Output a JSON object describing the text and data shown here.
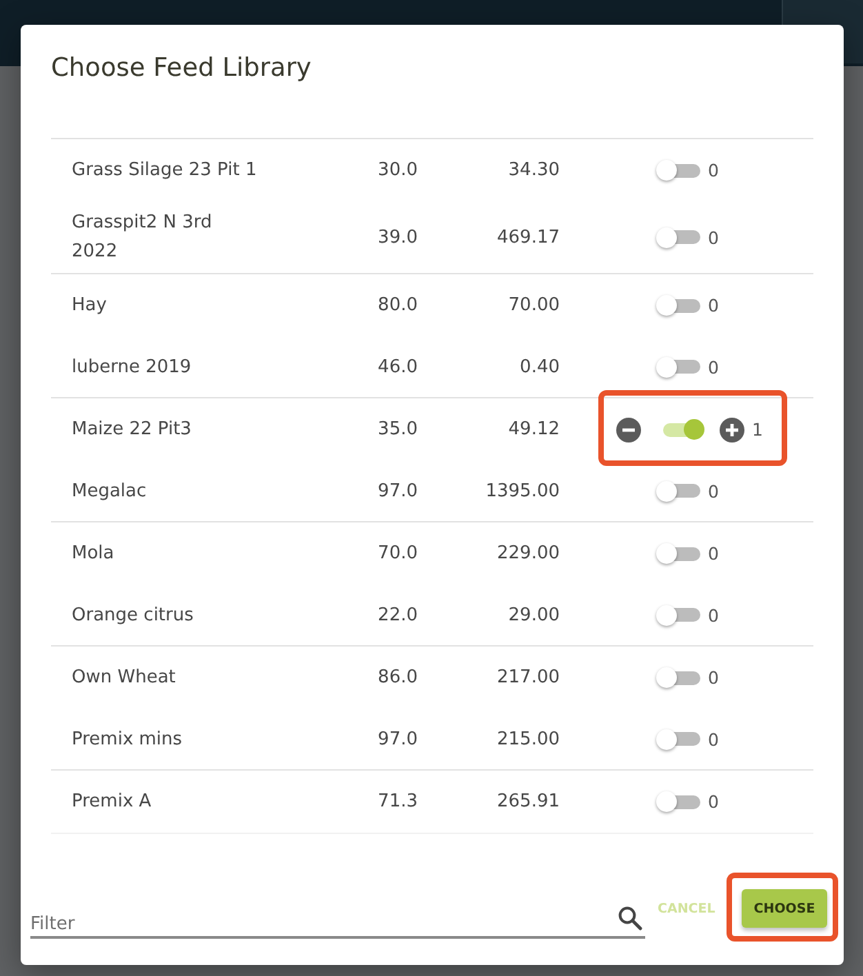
{
  "dialog": {
    "title": "Choose Feed Library"
  },
  "rows": [
    {
      "name": "Grass Silage 23 Pit 1",
      "column_2": "30.0",
      "column_3": "34.30",
      "on": false,
      "count": "0",
      "highlighted": false
    },
    {
      "name": "Grasspit2 N 3rd 2022",
      "column_2": "39.0",
      "column_3": "469.17",
      "on": false,
      "count": "0",
      "highlighted": false
    },
    {
      "name": "Hay",
      "column_2": "80.0",
      "column_3": "70.00",
      "on": false,
      "count": "0",
      "highlighted": false
    },
    {
      "name": "luberne 2019",
      "column_2": "46.0",
      "column_3": "0.40",
      "on": false,
      "count": "0",
      "highlighted": false
    },
    {
      "name": "Maize 22 Pit3",
      "column_2": "35.0",
      "column_3": "49.12",
      "on": true,
      "count": "1",
      "highlighted": true
    },
    {
      "name": "Megalac",
      "column_2": "97.0",
      "column_3": "1395.00",
      "on": false,
      "count": "0",
      "highlighted": false
    },
    {
      "name": "Mola",
      "column_2": "70.0",
      "column_3": "229.00",
      "on": false,
      "count": "0",
      "highlighted": false
    },
    {
      "name": "Orange citrus",
      "column_2": "22.0",
      "column_3": "29.00",
      "on": false,
      "count": "0",
      "highlighted": false
    },
    {
      "name": "Own Wheat",
      "column_2": "86.0",
      "column_3": "217.00",
      "on": false,
      "count": "0",
      "highlighted": false
    },
    {
      "name": "Premix mins",
      "column_2": "97.0",
      "column_3": "215.00",
      "on": false,
      "count": "0",
      "highlighted": false
    },
    {
      "name": "Premix A",
      "column_2": "71.3",
      "column_3": "265.91",
      "on": false,
      "count": "0",
      "highlighted": false
    }
  ],
  "filter": {
    "placeholder": "Filter"
  },
  "cancel_button": {
    "label": "CANCEL"
  },
  "choose_button": {
    "label": "CHOOSE",
    "highlighted": true
  }
}
